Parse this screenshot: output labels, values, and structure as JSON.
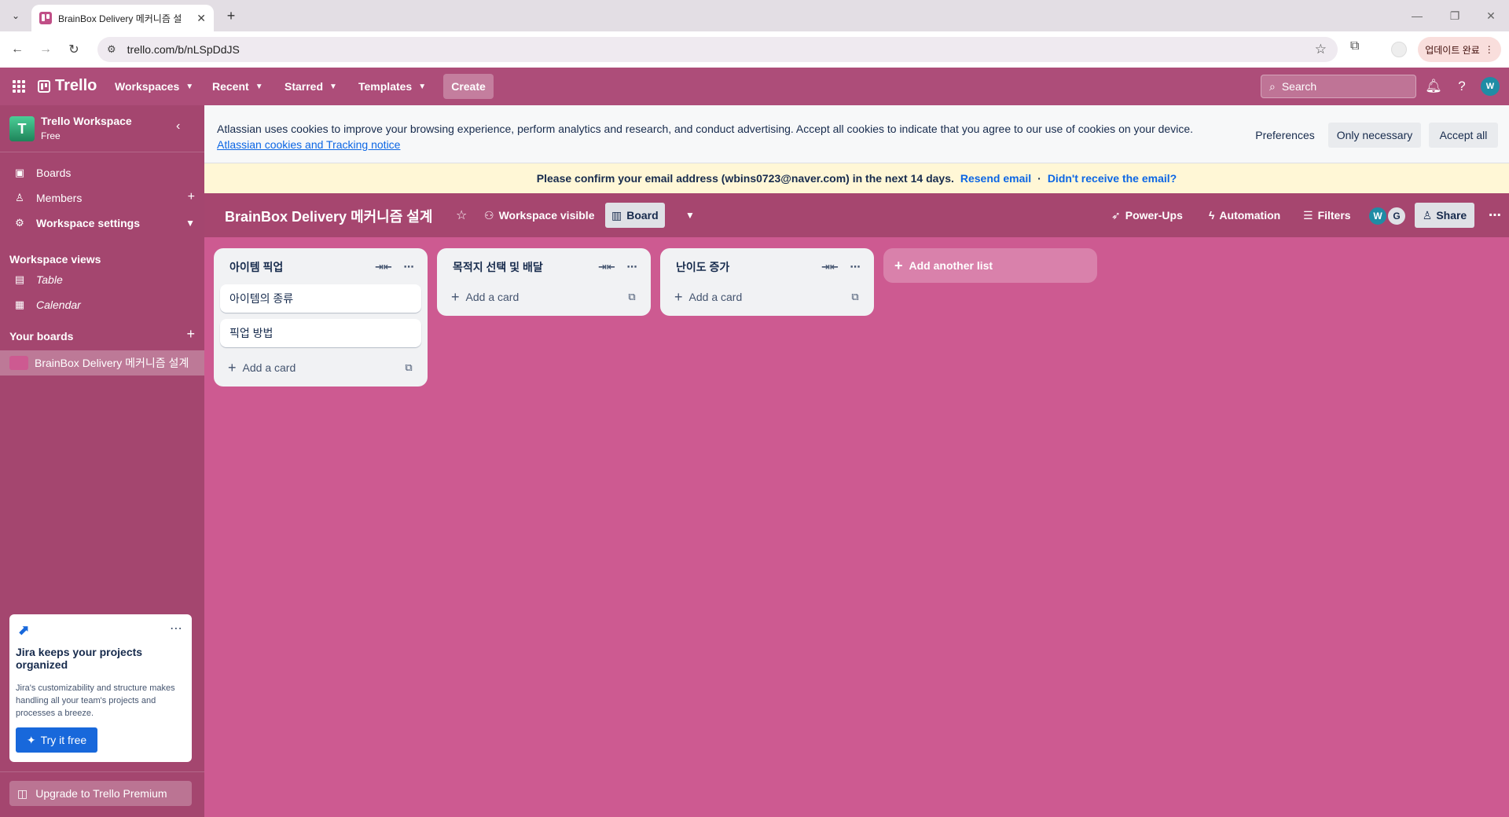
{
  "browser": {
    "tab_title": "BrainBox Delivery 메커니즘 설",
    "url": "trello.com/b/nLSpDdJS",
    "update_label": "업데이트 완료"
  },
  "header": {
    "logo": "Trello",
    "menus": [
      "Workspaces",
      "Recent",
      "Starred",
      "Templates"
    ],
    "create_label": "Create",
    "search_placeholder": "Search",
    "avatar_initial": "W"
  },
  "sidebar": {
    "workspace_initial": "T",
    "workspace_name": "Trello Workspace",
    "workspace_plan": "Free",
    "items": [
      {
        "label": "Boards"
      },
      {
        "label": "Members"
      },
      {
        "label": "Workspace settings"
      }
    ],
    "views_heading": "Workspace views",
    "views": [
      {
        "label": "Table"
      },
      {
        "label": "Calendar"
      }
    ],
    "boards_heading": "Your boards",
    "active_board": "BrainBox Delivery 메커니즘 설계",
    "jira": {
      "title": "Jira keeps your projects organized",
      "description": "Jira's customizability and structure makes handling all your team's projects and processes a breeze.",
      "button": "Try it free"
    },
    "upgrade_label": "Upgrade to Trello Premium"
  },
  "cookie": {
    "text": "Atlassian uses cookies to improve your browsing experience, perform analytics and research, and conduct advertising. Accept all cookies to indicate that you agree to our use of cookies on your device.",
    "link": "Atlassian cookies and Tracking notice",
    "preferences": "Preferences",
    "only_necessary": "Only necessary",
    "accept_all": "Accept all"
  },
  "email_bar": {
    "message": "Please confirm your email address (wbins0723@naver.com) in the next 14 days.",
    "resend": "Resend email",
    "separator": "·",
    "not_received": "Didn't receive the email?"
  },
  "board": {
    "title": "BrainBox Delivery 메커니즘 설계",
    "visibility": "Workspace visible",
    "view": "Board",
    "powerups": "Power-Ups",
    "automation": "Automation",
    "filters": "Filters",
    "members": [
      {
        "initial": "W",
        "color": "#1f8ca5"
      },
      {
        "initial": "G",
        "color": "#dfe1e6"
      }
    ],
    "share": "Share"
  },
  "lists": [
    {
      "title": "아이템 픽업",
      "cards": [
        "아이템의 종류",
        "픽업 방법"
      ],
      "add_card": "Add a card"
    },
    {
      "title": "목적지 선택 및 배달",
      "cards": [],
      "add_card": "Add a card"
    },
    {
      "title": "난이도 증가",
      "cards": [],
      "add_card": "Add a card"
    }
  ],
  "add_list_label": "Add another list",
  "colors": {
    "board_bg": "#cd5a91",
    "header_bg": "#ad4d79",
    "sidebar_bg": "#a4466f",
    "link": "#0c66e4"
  }
}
